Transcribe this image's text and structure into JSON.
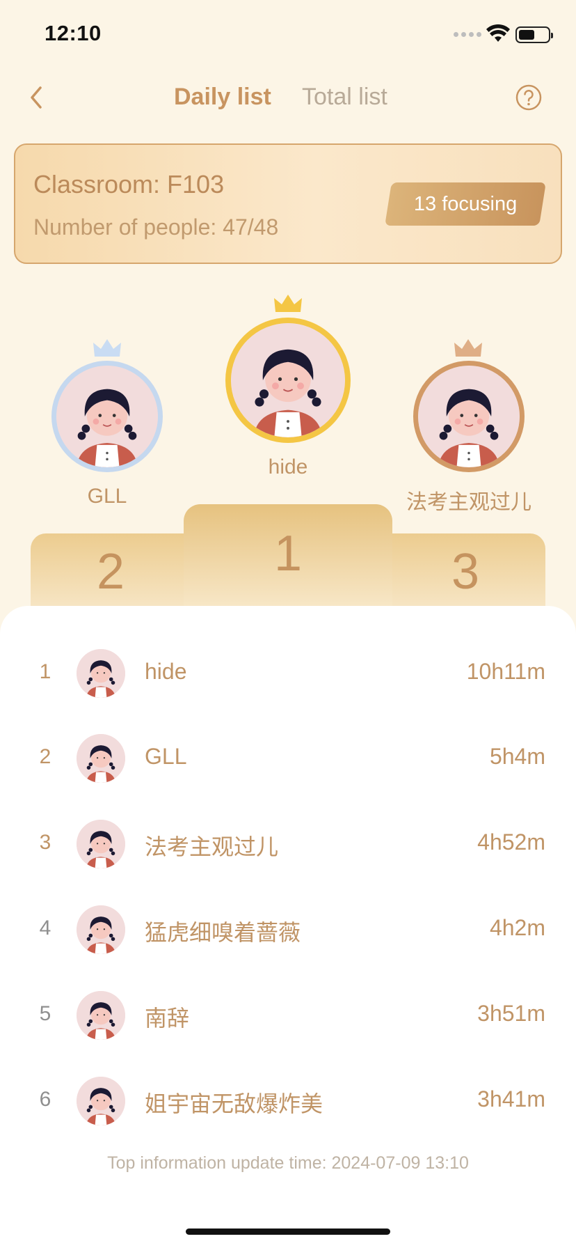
{
  "status_bar": {
    "time": "12:10"
  },
  "nav": {
    "tab_daily": "Daily list",
    "tab_total": "Total list",
    "back_icon": "chevron-left-icon",
    "help_icon": "question-circle-icon"
  },
  "classroom": {
    "title": "Classroom: F103",
    "people": "Number of people: 47/48",
    "focusing": "13 focusing"
  },
  "podium": [
    {
      "rank": "1",
      "name": "hide",
      "ring_color": "#f4c644",
      "crown_color": "#f4c644"
    },
    {
      "rank": "2",
      "name": "GLL",
      "ring_color": "#c5d8ef",
      "crown_color": "#c9dcf3"
    },
    {
      "rank": "3",
      "name": "法考主观过儿",
      "ring_color": "#d29a66",
      "crown_color": "#dfae86"
    }
  ],
  "ranking": [
    {
      "rank": "1",
      "name": "hide",
      "time": "10h11m"
    },
    {
      "rank": "2",
      "name": "GLL",
      "time": "5h4m"
    },
    {
      "rank": "3",
      "name": "法考主观过儿",
      "time": "4h52m"
    },
    {
      "rank": "4",
      "name": "猛虎细嗅着蔷薇",
      "time": "4h2m"
    },
    {
      "rank": "5",
      "name": "南辞",
      "time": "3h51m"
    },
    {
      "rank": "6",
      "name": "姐宇宙无敌爆炸美",
      "time": "3h41m"
    }
  ],
  "colors": {
    "top_rank": "#c09466",
    "other_rank": "#8f8f8f",
    "accent": "#c89460"
  },
  "footer": {
    "update_time": "Top information update time: 2024-07-09 13:10"
  }
}
